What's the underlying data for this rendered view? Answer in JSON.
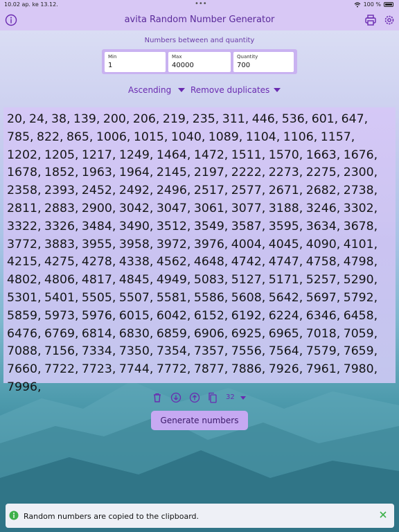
{
  "status": {
    "time": "10.02 ap.   ke 13.12.",
    "dots": "•••",
    "battery": "100 %"
  },
  "header": {
    "title": "avita Random Number Generator",
    "accent": "#6a2ab0"
  },
  "form": {
    "subtitle": "Numbers between and quantity",
    "min_label": "Min",
    "min_value": "1",
    "max_label": "Max",
    "max_value": "40000",
    "quantity_label": "Quantity",
    "quantity_value": "700"
  },
  "options": {
    "sort": "Ascending",
    "duplicates": "Remove duplicates"
  },
  "numbers": {
    "text": "20, 24, 38, 139, 200, 206, 219, 235, 311, 446, 536, 601, 647, 785, 822, 865, 1006, 1015, 1040, 1089, 1104, 1106, 1157, 1202, 1205, 1217, 1249, 1464, 1472, 1511, 1570, 1663, 1676, 1678, 1852, 1963, 1964, 2145, 2197, 2222, 2273, 2275, 2300, 2358, 2393, 2452, 2492, 2496, 2517, 2577, 2671, 2682, 2738, 2811, 2883, 2900, 3042, 3047, 3061, 3077, 3188, 3246, 3302, 3322, 3326, 3484, 3490, 3512, 3549, 3587, 3595, 3634, 3678, 3772, 3883, 3955, 3958, 3972, 3976, 4004, 4045, 4090, 4101, 4215, 4275, 4278, 4338, 4562, 4648, 4742, 4747, 4758, 4798, 4802, 4806, 4817, 4845, 4949, 5083, 5127, 5171, 5257, 5290, 5301, 5401, 5505, 5507, 5581, 5586, 5608, 5642, 5697, 5792, 5859, 5973, 5976, 6015, 6042, 6152, 6192, 6224, 6346, 6458, 6476, 6769, 6814, 6830, 6859, 6906, 6925, 6965, 7018, 7059, 7088, 7156, 7334, 7350, 7354, 7357, 7556, 7564, 7579, 7659, 7660, 7722, 7723, 7744, 7772, 7877, 7886, 7926, 7961, 7980, 7996,"
  },
  "toolbar": {
    "font_size": "32",
    "icons": [
      "trash-icon",
      "download-icon",
      "upload-icon",
      "copy-icon"
    ]
  },
  "actions": {
    "generate_label": "Generate numbers"
  },
  "toast": {
    "message": "Random numbers are copied to the clipboard.",
    "info_color": "#3db04a"
  }
}
